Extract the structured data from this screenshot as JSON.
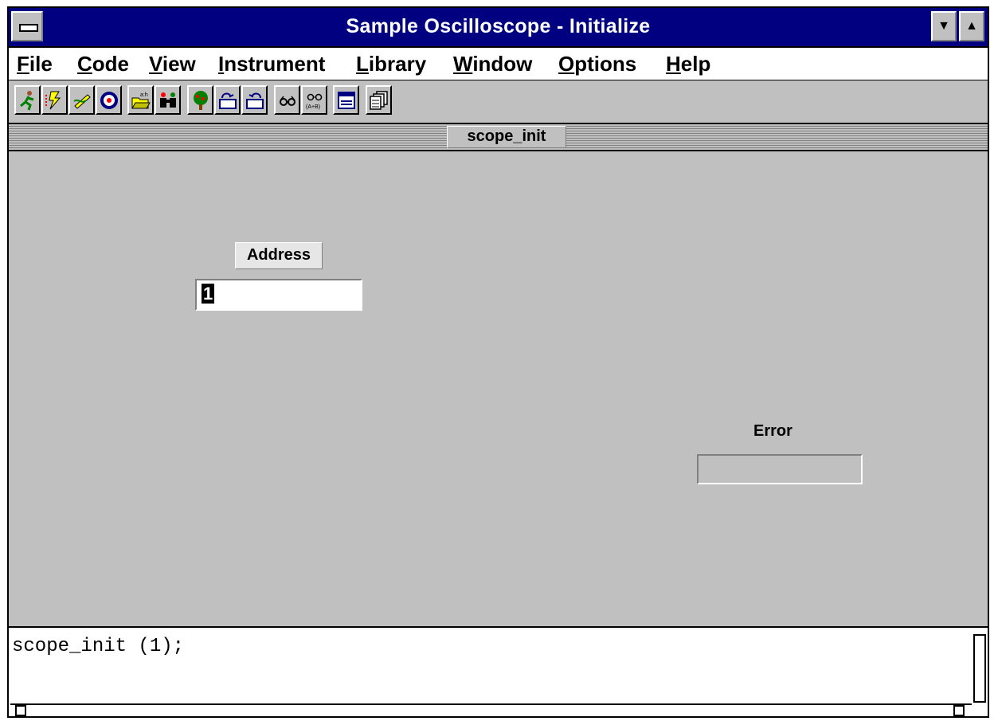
{
  "window": {
    "title": "Sample Oscilloscope - Initialize"
  },
  "menu": {
    "items": [
      {
        "key": "F",
        "rest": "ile"
      },
      {
        "key": "C",
        "rest": "ode"
      },
      {
        "key": "V",
        "rest": "iew"
      },
      {
        "key": "I",
        "rest": "nstrument"
      },
      {
        "key": "L",
        "rest": "ibrary"
      },
      {
        "key": "W",
        "rest": "indow"
      },
      {
        "key": "O",
        "rest": "ptions"
      },
      {
        "key": "H",
        "rest": "elp"
      }
    ]
  },
  "toolbar": {
    "buttons": [
      "run-icon",
      "lightning-icon",
      "hand-write-icon",
      "target-icon",
      "open-folder-icon",
      "binoculars-icon",
      "tree-icon",
      "panel-up-icon",
      "panel-down-icon",
      "glasses-icon",
      "glasses-ab-icon",
      "window-icon",
      "cascade-icon"
    ]
  },
  "panel": {
    "caption": "scope_init",
    "address_label": "Address",
    "address_value": "1",
    "error_label": "Error",
    "error_value": ""
  },
  "code": {
    "line": "scope_init (1);"
  },
  "colors": {
    "titlebar": "#000080",
    "face": "#c0c0c0"
  }
}
